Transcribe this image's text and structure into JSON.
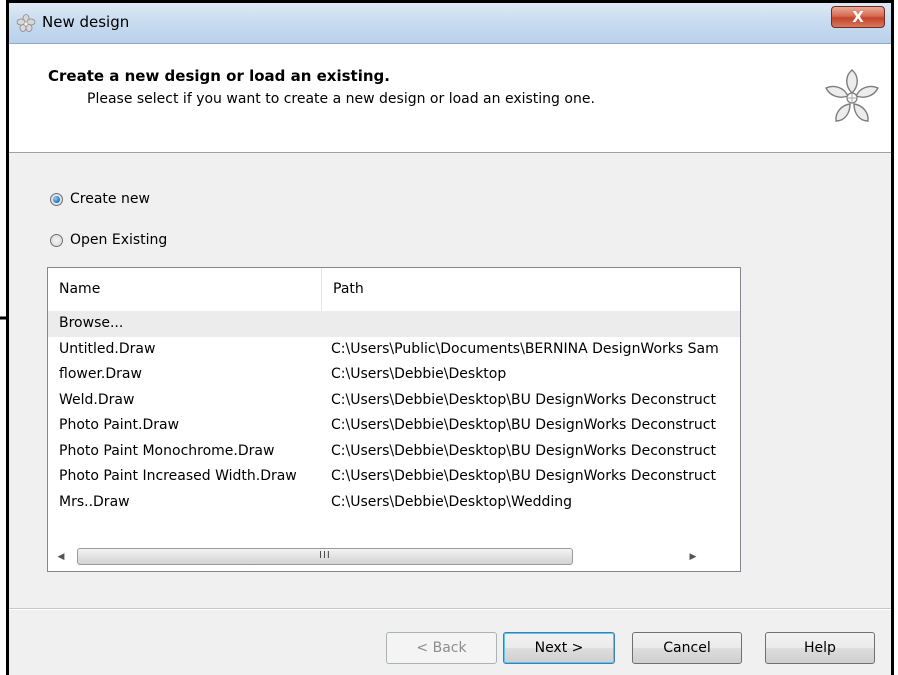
{
  "window": {
    "title": "New design",
    "close_label": "X"
  },
  "header": {
    "title": "Create a new design or load an existing.",
    "subtitle": "Please select if you want to create a new design or load an existing one."
  },
  "options": {
    "create_new": {
      "label": "Create new",
      "checked": true
    },
    "open_existing": {
      "label": "Open Existing",
      "checked": false
    }
  },
  "list": {
    "columns": {
      "name": "Name",
      "path": "Path"
    },
    "rows": [
      {
        "name": "Browse...",
        "path": ""
      },
      {
        "name": "Untitled.Draw",
        "path": "C:\\Users\\Public\\Documents\\BERNINA DesignWorks Sam"
      },
      {
        "name": "flower.Draw",
        "path": "C:\\Users\\Debbie\\Desktop"
      },
      {
        "name": "Weld.Draw",
        "path": "C:\\Users\\Debbie\\Desktop\\BU DesignWorks Deconstruct"
      },
      {
        "name": "Photo Paint.Draw",
        "path": "C:\\Users\\Debbie\\Desktop\\BU DesignWorks Deconstruct"
      },
      {
        "name": "Photo Paint  Monochrome.Draw",
        "path": "C:\\Users\\Debbie\\Desktop\\BU DesignWorks Deconstruct"
      },
      {
        "name": "Photo Paint  Increased Width.Draw",
        "path": "C:\\Users\\Debbie\\Desktop\\BU DesignWorks Deconstruct"
      },
      {
        "name": "Mrs..Draw",
        "path": "C:\\Users\\Debbie\\Desktop\\Wedding"
      }
    ],
    "scroll_grip": "III"
  },
  "buttons": {
    "back": "< Back",
    "next": "Next >",
    "cancel": "Cancel",
    "help": "Help"
  }
}
